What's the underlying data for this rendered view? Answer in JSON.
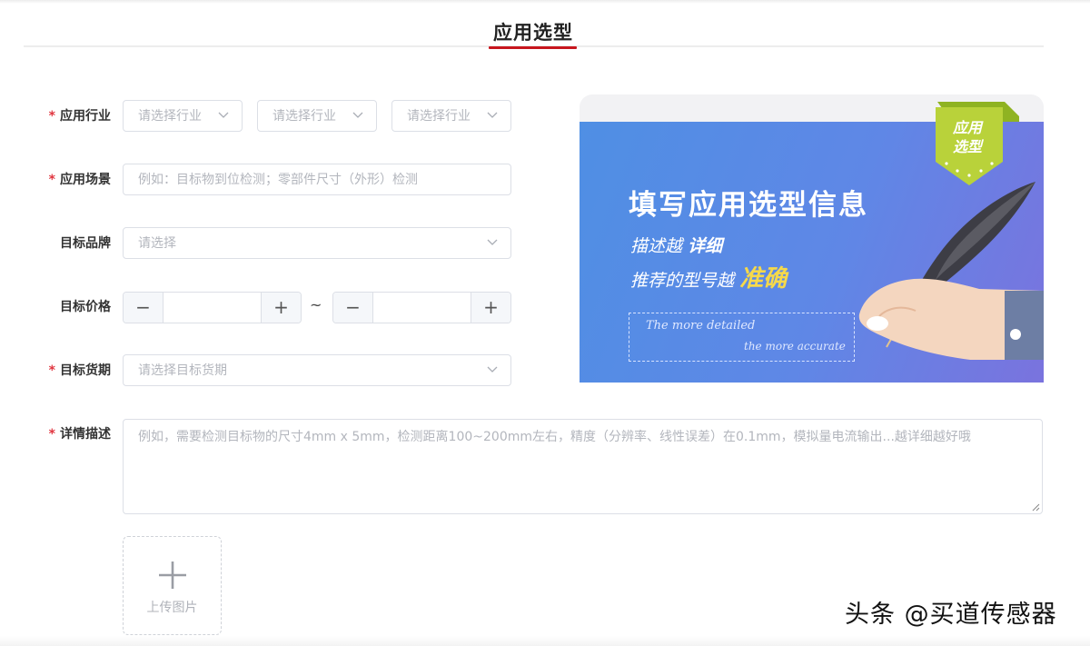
{
  "page": {
    "title": "应用选型"
  },
  "form": {
    "industry": {
      "label": "应用行业",
      "required_mark": "*",
      "selects": [
        {
          "placeholder": "请选择行业"
        },
        {
          "placeholder": "请选择行业"
        },
        {
          "placeholder": "请选择行业"
        }
      ]
    },
    "scenario": {
      "label": "应用场景",
      "required_mark": "*",
      "placeholder": "例如：目标物到位检测；零部件尺寸（外形）检测"
    },
    "brand": {
      "label": "目标品牌",
      "placeholder": "请选择"
    },
    "price": {
      "label": "目标价格",
      "minus": "−",
      "plus": "+",
      "separator": "~",
      "min_value": "",
      "max_value": ""
    },
    "delivery": {
      "label": "目标货期",
      "required_mark": "*",
      "placeholder": "请选择目标货期"
    },
    "details": {
      "label": "详情描述",
      "required_mark": "*",
      "placeholder": "例如，需要检测目标物的尺寸4mm x 5mm，检测距离100~200mm左右，精度（分辨率、线性误差）在0.1mm，模拟量电流输出...越详细越好哦"
    },
    "upload": {
      "label": "上传图片"
    }
  },
  "banner": {
    "ribbon_line1": "应用",
    "ribbon_line2": "选型",
    "headline": "填写应用选型信息",
    "line1_prefix": "描述越",
    "line1_bold": "详细",
    "line2_prefix": "推荐的型号越",
    "line2_accent": "准确",
    "english1": "The more detailed",
    "english2": "the more accurate"
  },
  "watermark": "头条 @买道传感器",
  "colors": {
    "accent_red": "#c8161e",
    "required_red": "#e0353f",
    "banner_blue": "#5b8be6",
    "banner_yellow": "#f6d94a",
    "ribbon_green": "#b9d23a"
  }
}
